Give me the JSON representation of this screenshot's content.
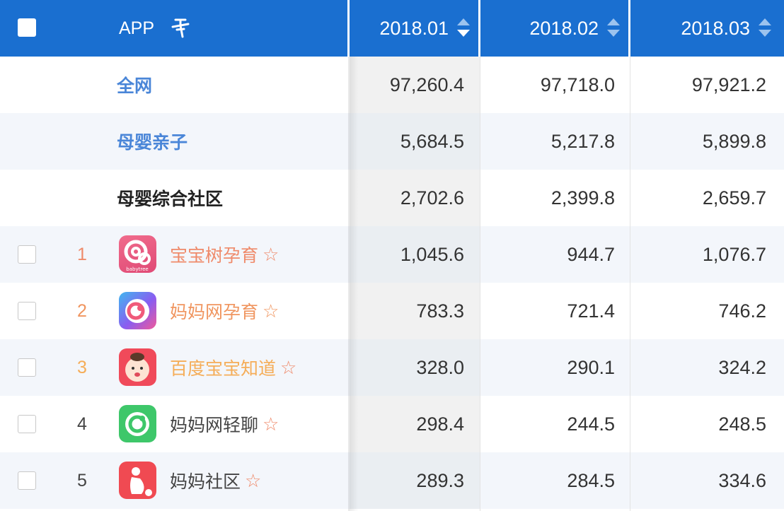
{
  "header": {
    "app_label": "APP",
    "pin_icon": "pin-icon",
    "columns": [
      "2018.01",
      "2018.02",
      "2018.03"
    ]
  },
  "category_rows": [
    {
      "name": "全网",
      "values": [
        "97,260.4",
        "97,718.0",
        "97,921.2"
      ],
      "color": "#4a86d8"
    },
    {
      "name": "母婴亲子",
      "values": [
        "5,684.5",
        "5,217.8",
        "5,899.8"
      ],
      "color": "#4a86d8"
    },
    {
      "name": "母婴综合社区",
      "values": [
        "2,702.6",
        "2,399.8",
        "2,659.7"
      ],
      "color": "#222222"
    }
  ],
  "app_rows": [
    {
      "rank": "1",
      "name": "宝宝树孕育",
      "icon": "babytree-app-icon",
      "icon_text": "babytree",
      "values": [
        "1,045.6",
        "944.7",
        "1,076.7"
      ],
      "color": "#ef8a6a"
    },
    {
      "rank": "2",
      "name": "妈妈网孕育",
      "icon": "mamanet-pregnancy-app-icon",
      "values": [
        "783.3",
        "721.4",
        "746.2"
      ],
      "color": "#f0955f"
    },
    {
      "rank": "3",
      "name": "百度宝宝知道",
      "icon": "baidu-baby-app-icon",
      "values": [
        "328.0",
        "290.1",
        "324.2"
      ],
      "color": "#f5ad58"
    },
    {
      "rank": "4",
      "name": "妈妈网轻聊",
      "icon": "mamanet-chat-app-icon",
      "values": [
        "298.4",
        "244.5",
        "248.5"
      ],
      "color": "#444444"
    },
    {
      "rank": "5",
      "name": "妈妈社区",
      "icon": "mama-community-app-icon",
      "values": [
        "289.3",
        "284.5",
        "334.6"
      ],
      "color": "#444444"
    }
  ],
  "colors": {
    "header_bg": "#1a6fd0",
    "star": "#ef8a6a"
  }
}
